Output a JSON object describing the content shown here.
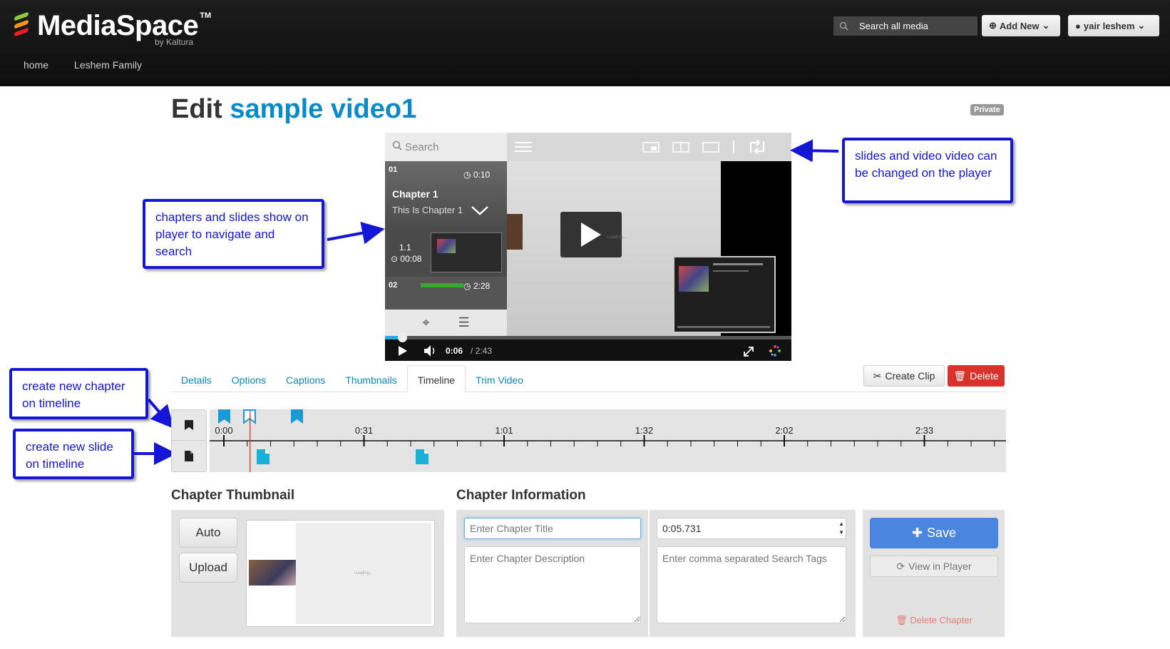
{
  "header": {
    "brand": "MediaSpace",
    "brand_tm": "TM",
    "brand_sub": "by Kaltura",
    "nav": [
      "home",
      "Leshem Family"
    ],
    "search_placeholder": "Search all media",
    "add_new_label": "Add New",
    "user_label": "yair leshem"
  },
  "page": {
    "title_prefix": "Edit",
    "video_name": "sample video1",
    "privacy_badge": "Private"
  },
  "player": {
    "search_placeholder": "Search",
    "chapter1": {
      "number": "01",
      "time": "0:10",
      "title": "Chapter 1",
      "description": "This Is Chapter 1"
    },
    "slide1": {
      "number": "1.1",
      "time": "00:08"
    },
    "chapter2": {
      "number": "02",
      "time": "2:28"
    },
    "current_time": "0:06",
    "duration": "/ 2:43",
    "progress_fraction": 0.04,
    "loading_text": "Loading..."
  },
  "callouts": {
    "layout_switch": "slides and video video can be changed on the player",
    "chapters_nav": "chapters and slides show on player to navigate and search",
    "new_chapter": "create new chapter on timeline",
    "new_slide": "create new slide on timeline"
  },
  "tabs": [
    "Details",
    "Options",
    "Captions",
    "Thumbnails",
    "Timeline",
    "Trim Video"
  ],
  "active_tab": "Timeline",
  "actions": {
    "create_clip": "Create Clip",
    "delete": "Delete"
  },
  "timeline": {
    "tick_labels": [
      "0:00",
      "0:31",
      "1:01",
      "1:32",
      "2:02",
      "2:33"
    ],
    "playhead_time_sec": 5.7
  },
  "chapter_thumbnail": {
    "title": "Chapter Thumbnail",
    "auto_label": "Auto",
    "upload_label": "Upload"
  },
  "chapter_info": {
    "title": "Chapter Information",
    "title_placeholder": "Enter Chapter Title",
    "time_value": "0:05.731",
    "description_placeholder": "Enter Chapter Description",
    "tags_placeholder": "Enter comma separated Search Tags",
    "save_label": "Save",
    "view_label": "View in Player",
    "delete_label": "Delete Chapter"
  },
  "colors": {
    "accent": "#0a8ac6",
    "callout": "#1515d6",
    "cue": "#1a9ad6",
    "danger": "#d9312b",
    "save": "#4a86e0"
  }
}
